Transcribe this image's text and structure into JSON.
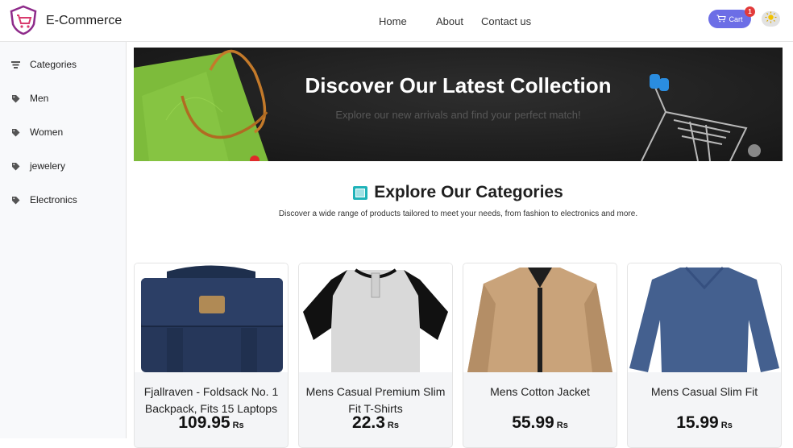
{
  "header": {
    "brand": "E-Commerce",
    "nav": [
      "Home",
      "About",
      "Contact us"
    ],
    "cart_label": "Cart",
    "cart_count": "1"
  },
  "sidebar": {
    "items": [
      {
        "label": "Categories",
        "icon": "list-icon"
      },
      {
        "label": "Men",
        "icon": "tag-icon"
      },
      {
        "label": "Women",
        "icon": "tag-icon"
      },
      {
        "label": "jewelery",
        "icon": "tag-icon"
      },
      {
        "label": "Electronics",
        "icon": "tag-icon"
      }
    ]
  },
  "hero": {
    "title": "Discover Our Latest Collection",
    "subtitle": "Explore our new arrivals and find your perfect match!"
  },
  "section": {
    "title": "Explore Our Categories",
    "subtitle": "Discover a wide range of products tailored to meet your needs, from fashion to electronics and more."
  },
  "products": [
    {
      "title": "Fjallraven - Foldsack No. 1 Backpack, Fits 15 Laptops",
      "price": "109.95",
      "currency": "Rs"
    },
    {
      "title": "Mens Casual Premium Slim Fit T-Shirts",
      "price": "22.3",
      "currency": "Rs"
    },
    {
      "title": "Mens Cotton Jacket",
      "price": "55.99",
      "currency": "Rs"
    },
    {
      "title": "Mens Casual Slim Fit",
      "price": "15.99",
      "currency": "Rs"
    }
  ],
  "colors": {
    "accent": "#6c6ee6",
    "badge": "#e23b3b",
    "section_icon": "#1fb3b9"
  }
}
